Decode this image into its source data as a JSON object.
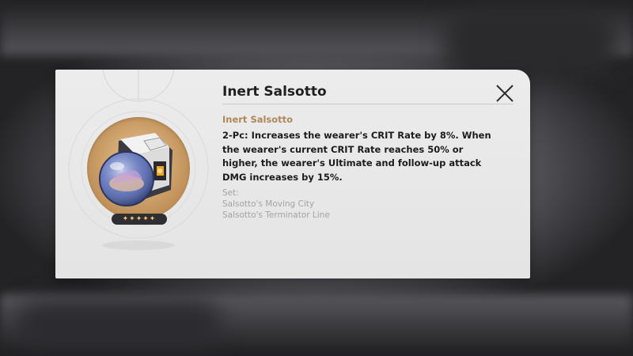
{
  "dialog": {
    "title": "Inert Salsotto",
    "close_icon": "close-icon",
    "relic": {
      "name_label": "Inert Salsotto",
      "rarity_stars": 5,
      "stars_text": "✦✦✦✦✦",
      "image": "relic-sphere-icon"
    },
    "description": "2-Pc: Increases the wearer's CRIT Rate by 8%. When the wearer's current CRIT Rate reaches 50% or higher, the wearer's Ultimate and follow-up attack DMG increases by 15%.",
    "set_label": "Set:",
    "set_items": [
      "Salsotto's Moving City",
      "Salsotto's Terminator Line"
    ]
  },
  "colors": {
    "accent": "#b0875a",
    "panel": "#e8e8e8",
    "star": "#f2c768"
  }
}
